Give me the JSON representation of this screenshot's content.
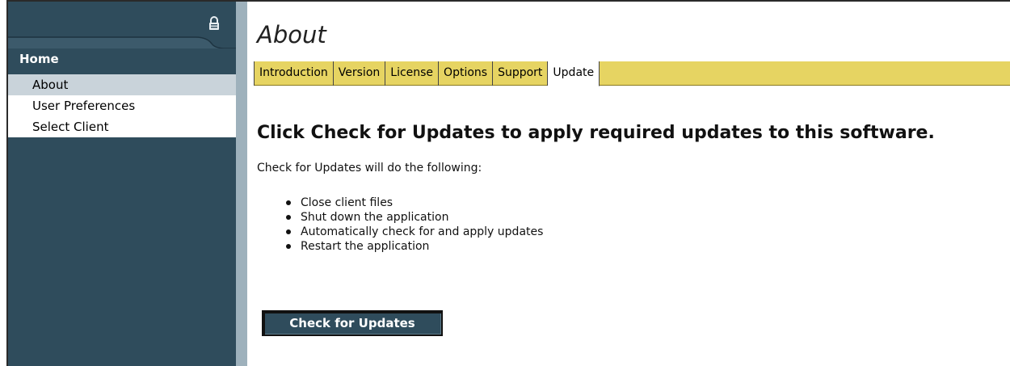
{
  "sidebar": {
    "home_label": "Home",
    "items": [
      {
        "label": "About",
        "active": true
      },
      {
        "label": "User Preferences",
        "active": false
      },
      {
        "label": "Select Client",
        "active": false
      }
    ]
  },
  "content": {
    "title": "About",
    "tabs": [
      {
        "label": "Introduction",
        "active": false
      },
      {
        "label": "Version",
        "active": false
      },
      {
        "label": "License",
        "active": false
      },
      {
        "label": "Options",
        "active": false
      },
      {
        "label": "Support",
        "active": false
      },
      {
        "label": "Update",
        "active": true
      }
    ],
    "heading": "Click Check for Updates to apply required updates to this software.",
    "intro": "Check for Updates will do the following:",
    "steps": [
      "Close client files",
      "Shut down the application",
      "Automatically check for and apply updates",
      "Restart the application"
    ],
    "button_label": "Check for Updates"
  },
  "colors": {
    "sidebar_bg": "#2f4c5c",
    "active_nav_bg": "#c9d3da",
    "tab_bar_bg": "#e6d462",
    "divider": "#9eb1bc"
  }
}
